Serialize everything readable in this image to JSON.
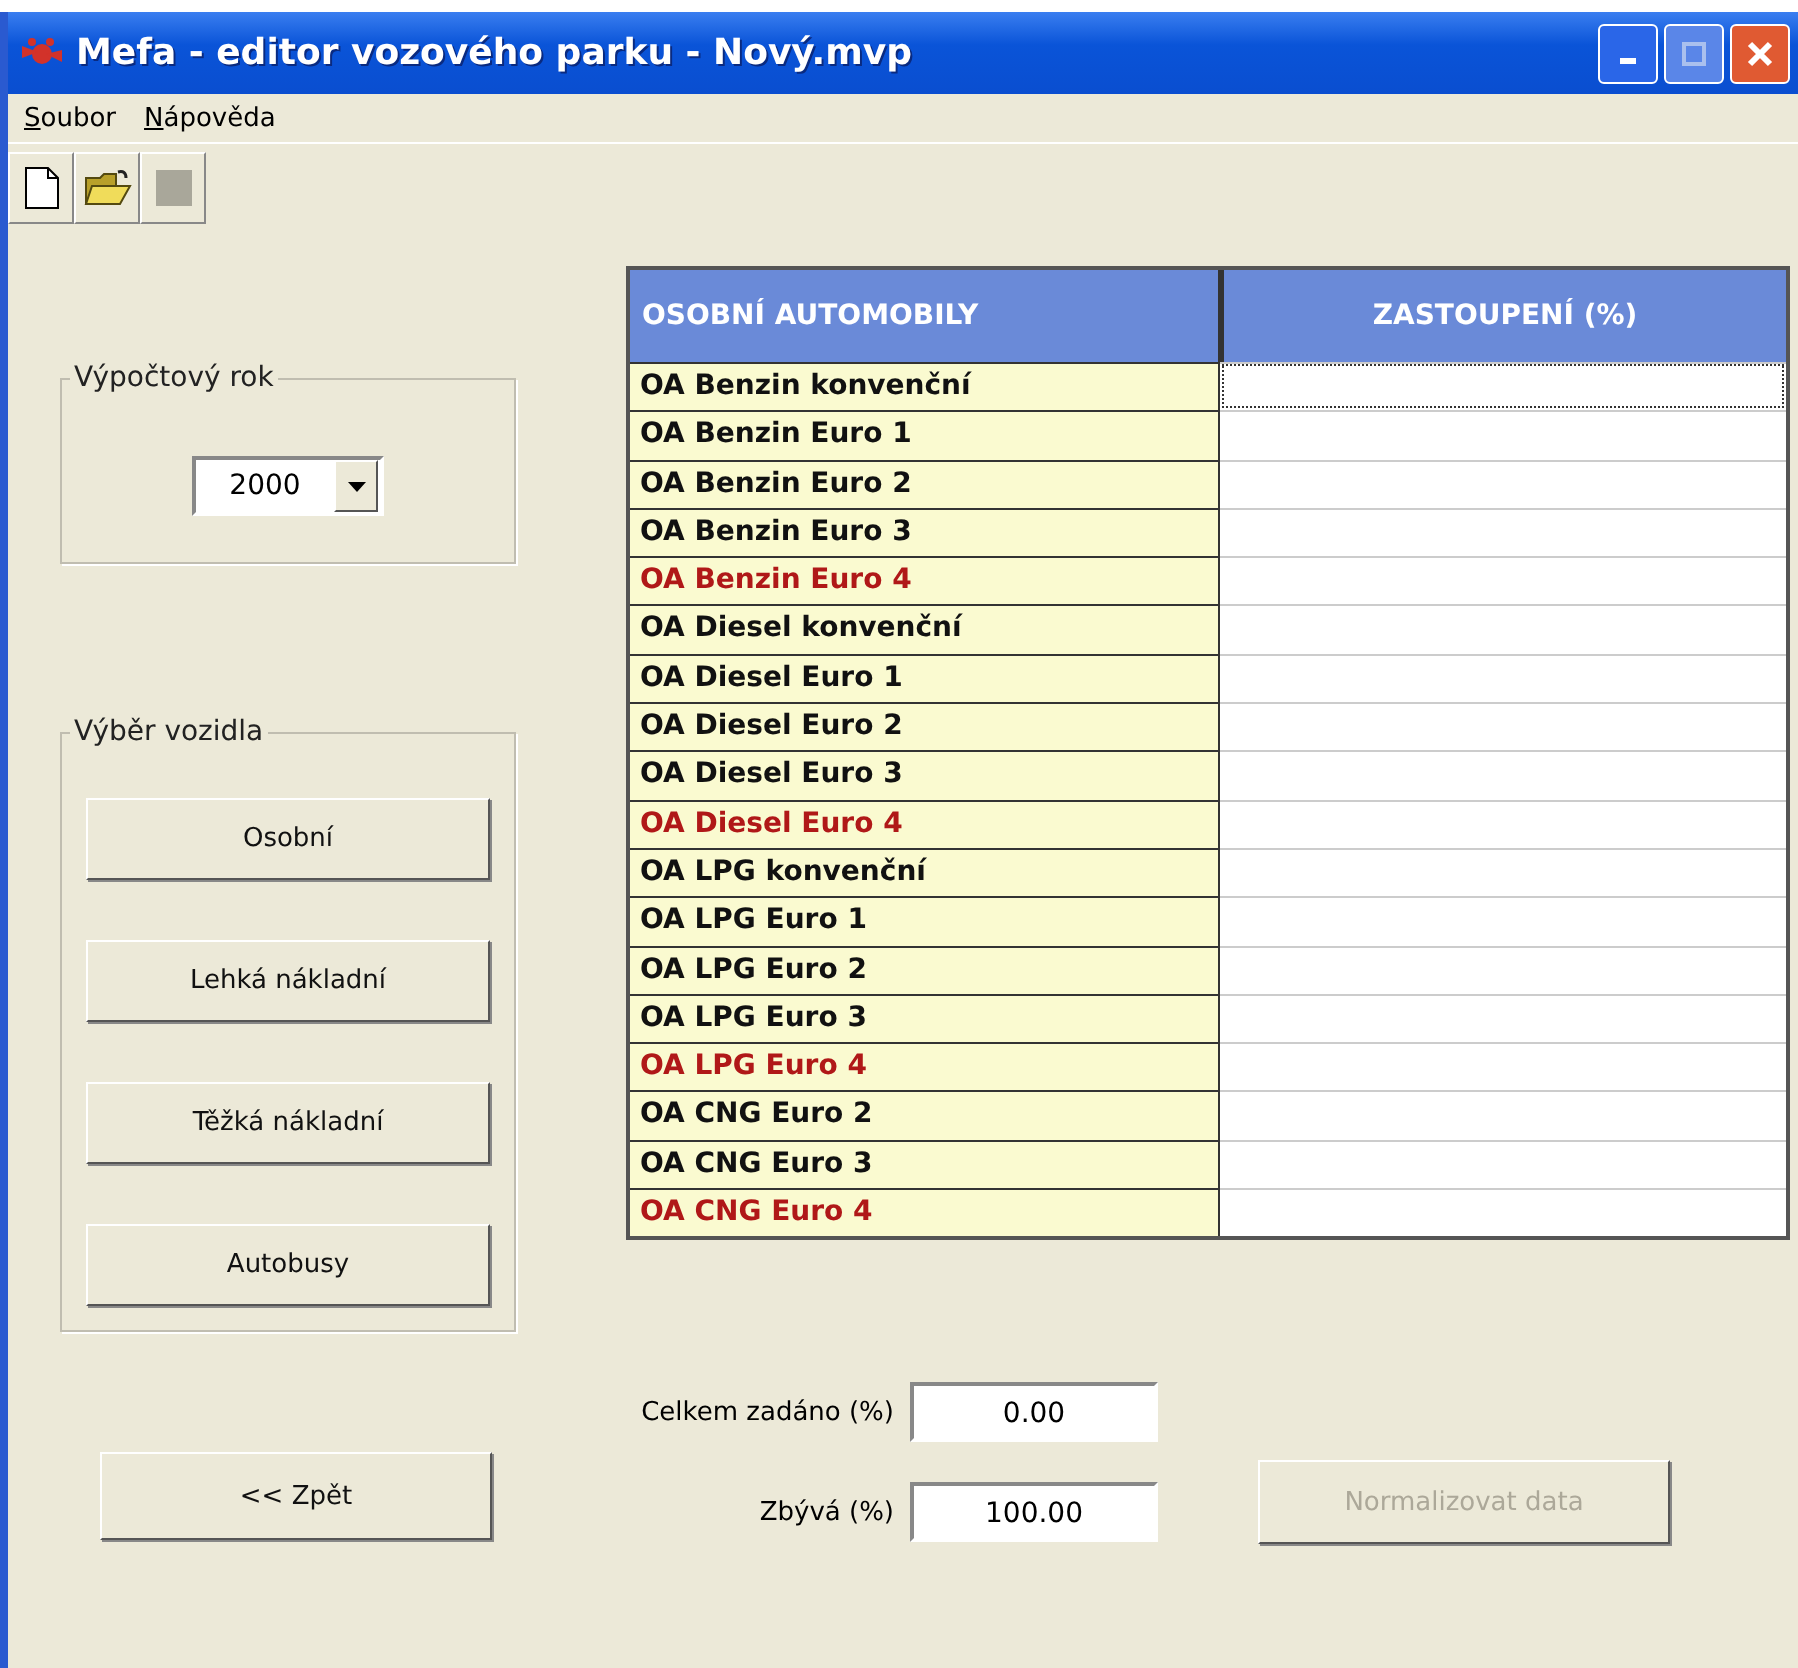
{
  "window": {
    "title": "Mefa - editor vozového parku - Nový.mvp"
  },
  "menu": [
    {
      "label": "Soubor"
    },
    {
      "label": "Nápověda"
    }
  ],
  "toolbar": [
    {
      "kind": "new"
    },
    {
      "kind": "open"
    },
    {
      "kind": "blank"
    }
  ],
  "year_group": {
    "title": "Výpočtový rok",
    "value": "2000"
  },
  "vehicle_group": {
    "title": "Výběr vozidla",
    "buttons": [
      "Osobní",
      "Lehká nákladní",
      "Těžká nákladní",
      "Autobusy"
    ]
  },
  "table": {
    "columns": [
      "OSOBNÍ AUTOMOBILY",
      "ZASTOUPENÍ (%)"
    ],
    "rows": [
      {
        "label": "OA Benzin konvenční",
        "highlighted": false,
        "focused": true
      },
      {
        "label": "OA Benzin Euro 1",
        "highlighted": false,
        "focused": false
      },
      {
        "label": "OA Benzin Euro 2",
        "highlighted": false,
        "focused": false
      },
      {
        "label": "OA Benzin Euro 3",
        "highlighted": false,
        "focused": false
      },
      {
        "label": "OA Benzin Euro 4",
        "highlighted": true,
        "focused": false
      },
      {
        "label": "OA Diesel konvenční",
        "highlighted": false,
        "focused": false
      },
      {
        "label": "OA Diesel Euro 1",
        "highlighted": false,
        "focused": false
      },
      {
        "label": "OA Diesel Euro 2",
        "highlighted": false,
        "focused": false
      },
      {
        "label": "OA Diesel Euro 3",
        "highlighted": false,
        "focused": false
      },
      {
        "label": "OA Diesel Euro 4",
        "highlighted": true,
        "focused": false
      },
      {
        "label": "OA LPG konvenční",
        "highlighted": false,
        "focused": false
      },
      {
        "label": "OA LPG Euro 1",
        "highlighted": false,
        "focused": false
      },
      {
        "label": "OA LPG Euro 2",
        "highlighted": false,
        "focused": false
      },
      {
        "label": "OA LPG Euro 3",
        "highlighted": false,
        "focused": false
      },
      {
        "label": "OA LPG Euro 4",
        "highlighted": true,
        "focused": false
      },
      {
        "label": "OA CNG Euro 2",
        "highlighted": false,
        "focused": false
      },
      {
        "label": "OA CNG Euro 3",
        "highlighted": false,
        "focused": false
      },
      {
        "label": "OA CNG Euro 4",
        "highlighted": true,
        "focused": false
      }
    ]
  },
  "back_button": {
    "label": "<< Zpět"
  },
  "totals": [
    {
      "label": "Celkem zadáno (%)",
      "value": "0.00"
    },
    {
      "label": "Zbývá (%)",
      "value": "100.00"
    }
  ],
  "normalize_button": {
    "label": "Normalizovat data",
    "disabled": true
  }
}
